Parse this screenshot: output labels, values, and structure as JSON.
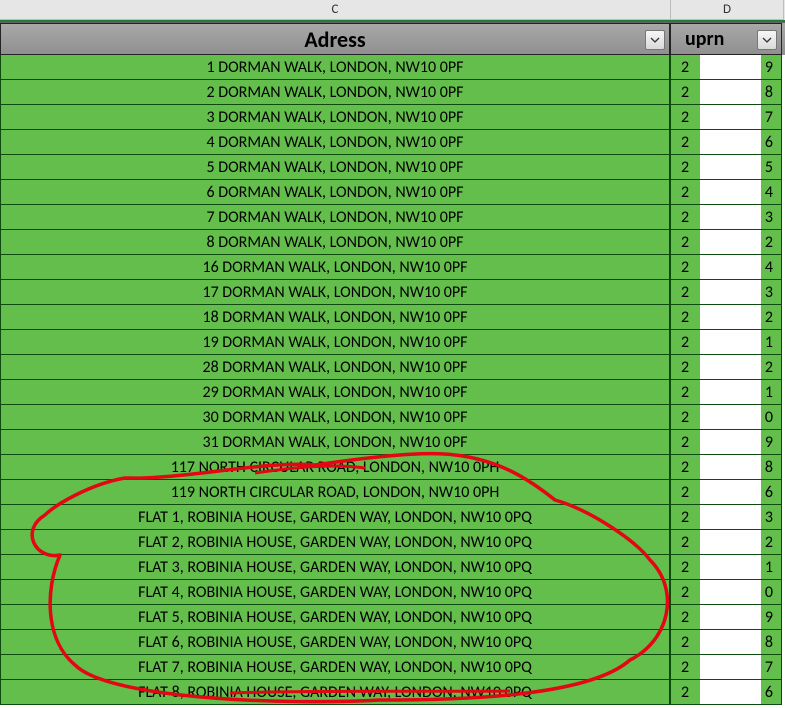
{
  "columns": {
    "C": "C",
    "D": "D"
  },
  "headers": {
    "address": "Adress",
    "uprn": "uprn"
  },
  "rows": [
    {
      "address": "1 DORMAN WALK, LONDON, NW10 0PF",
      "uprn_left": "2",
      "uprn_right": "9"
    },
    {
      "address": "2 DORMAN WALK, LONDON, NW10 0PF",
      "uprn_left": "2",
      "uprn_right": "8"
    },
    {
      "address": "3 DORMAN WALK, LONDON, NW10 0PF",
      "uprn_left": "2",
      "uprn_right": "7"
    },
    {
      "address": "4 DORMAN WALK, LONDON, NW10 0PF",
      "uprn_left": "2",
      "uprn_right": "6"
    },
    {
      "address": "5 DORMAN WALK, LONDON, NW10 0PF",
      "uprn_left": "2",
      "uprn_right": "5"
    },
    {
      "address": "6 DORMAN WALK, LONDON, NW10 0PF",
      "uprn_left": "2",
      "uprn_right": "4"
    },
    {
      "address": "7 DORMAN WALK, LONDON, NW10 0PF",
      "uprn_left": "2",
      "uprn_right": "3"
    },
    {
      "address": "8 DORMAN WALK, LONDON, NW10 0PF",
      "uprn_left": "2",
      "uprn_right": "2"
    },
    {
      "address": "16 DORMAN WALK, LONDON, NW10 0PF",
      "uprn_left": "2",
      "uprn_right": "4"
    },
    {
      "address": "17 DORMAN WALK, LONDON, NW10 0PF",
      "uprn_left": "2",
      "uprn_right": "3"
    },
    {
      "address": "18 DORMAN WALK, LONDON, NW10 0PF",
      "uprn_left": "2",
      "uprn_right": "2"
    },
    {
      "address": "19 DORMAN WALK, LONDON, NW10 0PF",
      "uprn_left": "2",
      "uprn_right": "1"
    },
    {
      "address": "28 DORMAN WALK, LONDON, NW10 0PF",
      "uprn_left": "2",
      "uprn_right": "2"
    },
    {
      "address": "29 DORMAN WALK, LONDON, NW10 0PF",
      "uprn_left": "2",
      "uprn_right": "1"
    },
    {
      "address": "30 DORMAN WALK, LONDON, NW10 0PF",
      "uprn_left": "2",
      "uprn_right": "0"
    },
    {
      "address": "31 DORMAN WALK, LONDON, NW10 0PF",
      "uprn_left": "2",
      "uprn_right": "9"
    },
    {
      "address": "117 NORTH CIRCULAR ROAD, LONDON, NW10 0PH",
      "uprn_left": "2",
      "uprn_right": "8"
    },
    {
      "address": "119 NORTH CIRCULAR ROAD, LONDON, NW10 0PH",
      "uprn_left": "2",
      "uprn_right": "6"
    },
    {
      "address": "FLAT 1, ROBINIA HOUSE, GARDEN WAY, LONDON, NW10 0PQ",
      "uprn_left": "2",
      "uprn_right": "3"
    },
    {
      "address": "FLAT 2, ROBINIA HOUSE, GARDEN WAY, LONDON, NW10 0PQ",
      "uprn_left": "2",
      "uprn_right": "2"
    },
    {
      "address": "FLAT 3, ROBINIA HOUSE, GARDEN WAY, LONDON, NW10 0PQ",
      "uprn_left": "2",
      "uprn_right": "1"
    },
    {
      "address": "FLAT 4, ROBINIA HOUSE, GARDEN WAY, LONDON, NW10 0PQ",
      "uprn_left": "2",
      "uprn_right": "0"
    },
    {
      "address": "FLAT 5, ROBINIA HOUSE, GARDEN WAY, LONDON, NW10 0PQ",
      "uprn_left": "2",
      "uprn_right": "9"
    },
    {
      "address": "FLAT 6, ROBINIA HOUSE, GARDEN WAY, LONDON, NW10 0PQ",
      "uprn_left": "2",
      "uprn_right": "8"
    },
    {
      "address": "FLAT 7, ROBINIA HOUSE, GARDEN WAY, LONDON, NW10 0PQ",
      "uprn_left": "2",
      "uprn_right": "7"
    },
    {
      "address": "FLAT 8, ROBINIA HOUSE, GARDEN WAY, LONDON, NW10 0PQ",
      "uprn_left": "2",
      "uprn_right": "6"
    }
  ]
}
